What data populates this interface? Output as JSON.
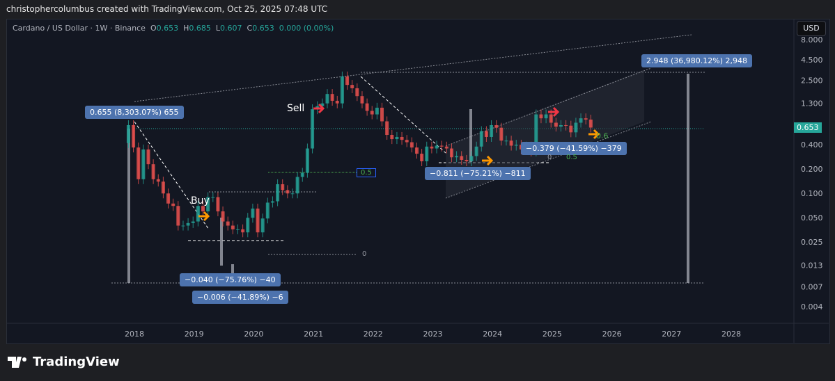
{
  "credit": "christophercolumbus created with TradingView.com, Oct 25, 2025 07:48 UTC",
  "legend": {
    "symbol": "Cardano / US Dollar · 1W · Binance",
    "o_label": "O",
    "o": "0.653",
    "h_label": "H",
    "h": "0.685",
    "l_label": "L",
    "l": "0.607",
    "c_label": "C",
    "c": "0.653",
    "change": "0.000 (0.00%)"
  },
  "currency_button": "USD",
  "current_price": "0.653",
  "annotations": {
    "a1": "0.655 (8,303.07%) 655",
    "a2": "−0.040 (−75.76%) −40",
    "a3": "−0.006 (−41.89%) −6",
    "a4": "−0.811 (−75.21%) −811",
    "a5": "−0.379 (−41.59%) −379",
    "a6": "2.948 (36,980.12%) 2,948",
    "sell": "Sell",
    "buy": "Buy",
    "fib_a": "0.5",
    "fib_b": "0",
    "fib_c": "0.5",
    "fib_d": "0.6",
    "fib_e": "0"
  },
  "brand": "TradingView",
  "chart_data": {
    "type": "candlestick",
    "title": "Cardano / US Dollar · 1W · Binance",
    "scale": "log",
    "y_ticks": [
      "8.000",
      "4.500",
      "2.500",
      "1.300",
      "0.400",
      "0.200",
      "0.100",
      "0.050",
      "0.025",
      "0.013",
      "0.007",
      "0.004"
    ],
    "x_ticks": [
      "2018",
      "2019",
      "2020",
      "2021",
      "2022",
      "2023",
      "2024",
      "2025",
      "2026",
      "2027",
      "2028"
    ],
    "start_year": 2017.9,
    "step_years": 0.0833,
    "monthly_closes": [
      0.7,
      0.37,
      0.15,
      0.35,
      0.23,
      0.15,
      0.14,
      0.1,
      0.075,
      0.07,
      0.04,
      0.04,
      0.043,
      0.045,
      0.07,
      0.06,
      0.09,
      0.09,
      0.06,
      0.045,
      0.04,
      0.036,
      0.036,
      0.033,
      0.05,
      0.065,
      0.033,
      0.049,
      0.077,
      0.08,
      0.13,
      0.11,
      0.1,
      0.1,
      0.16,
      0.18,
      0.36,
      1.1,
      1.2,
      1.3,
      1.7,
      1.4,
      1.3,
      2.8,
      2.2,
      2.0,
      1.6,
      1.3,
      1.05,
      0.95,
      1.15,
      0.78,
      0.53,
      0.47,
      0.5,
      0.46,
      0.43,
      0.37,
      0.31,
      0.25,
      0.38,
      0.36,
      0.39,
      0.38,
      0.36,
      0.28,
      0.29,
      0.26,
      0.25,
      0.29,
      0.38,
      0.59,
      0.5,
      0.7,
      0.65,
      0.45,
      0.45,
      0.39,
      0.4,
      0.35,
      0.38,
      0.33,
      0.95,
      0.85,
      0.95,
      0.75,
      0.67,
      0.7,
      0.69,
      0.57,
      0.75,
      0.85,
      0.82,
      0.653
    ],
    "colors": {
      "up": "#26a69a",
      "down": "#ef5350",
      "label": "#4d73ae"
    }
  }
}
